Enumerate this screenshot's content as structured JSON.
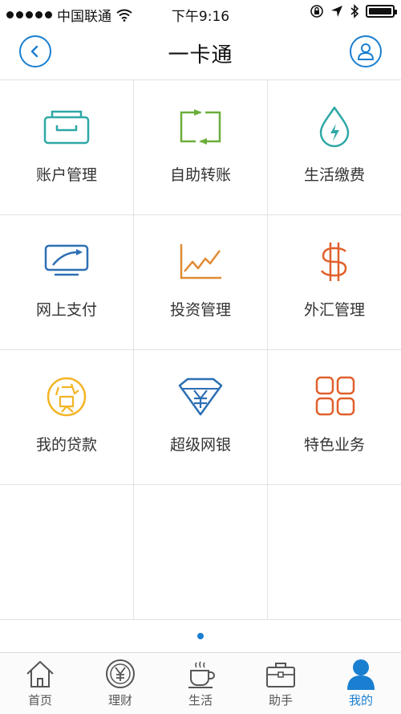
{
  "status_bar": {
    "carrier": "中国联通",
    "time": "下午9:16"
  },
  "nav": {
    "title": "一卡通",
    "back_icon": "chevron-left-icon",
    "user_icon": "user-icon"
  },
  "colors": {
    "accent": "#1a7fd0",
    "teal": "#2fa8a6",
    "green": "#6aae3a",
    "orange": "#e08a35",
    "red_orange": "#e0602c",
    "yellow": "#f2b526",
    "blue": "#2d6fb4"
  },
  "grid": {
    "items": [
      {
        "label": "账户管理",
        "icon": "account-folder-icon"
      },
      {
        "label": "自助转账",
        "icon": "transfer-arrows-icon"
      },
      {
        "label": "生活缴费",
        "icon": "water-lightning-icon"
      },
      {
        "label": "网上支付",
        "icon": "online-pay-screen-icon"
      },
      {
        "label": "投资管理",
        "icon": "line-chart-icon"
      },
      {
        "label": "外汇管理",
        "icon": "currency-symbol-icon"
      },
      {
        "label": "我的贷款",
        "icon": "loan-coin-icon"
      },
      {
        "label": "超级网银",
        "icon": "diamond-yen-icon"
      },
      {
        "label": "特色业务",
        "icon": "grid-squares-icon"
      }
    ]
  },
  "tabs": [
    {
      "label": "首页",
      "icon": "home-icon"
    },
    {
      "label": "理财",
      "icon": "yen-coin-icon"
    },
    {
      "label": "生活",
      "icon": "coffee-cup-icon"
    },
    {
      "label": "助手",
      "icon": "briefcase-icon"
    },
    {
      "label": "我的",
      "icon": "user-icon",
      "active": true
    }
  ]
}
